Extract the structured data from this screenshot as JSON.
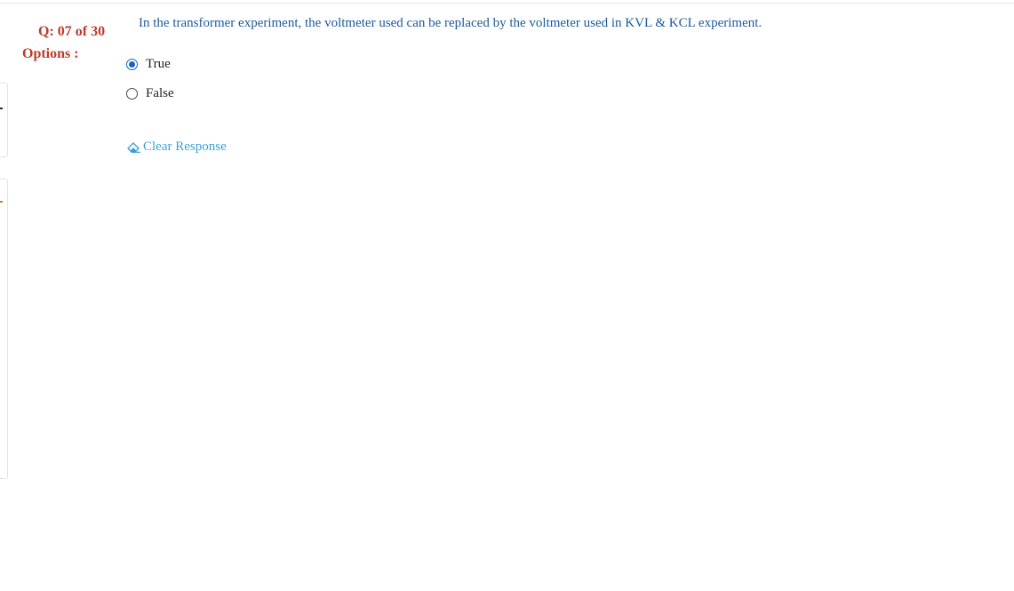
{
  "question_panel": {
    "number_label": "Q: 07 of 30",
    "options_label": "Options :",
    "question_text": "In the transformer experiment, the voltmeter used can be replaced by the voltmeter used in KVL & KCL experiment.",
    "options": [
      {
        "label": "True",
        "selected": true
      },
      {
        "label": "False",
        "selected": false
      }
    ],
    "clear_response_label": "Clear Response",
    "clear_icon": "eraser-icon"
  },
  "colors": {
    "question_label": "#c0392b",
    "question_text": "#1d5a9a",
    "radio_selected": "#1565c0",
    "clear_link": "#3aa3d4"
  }
}
